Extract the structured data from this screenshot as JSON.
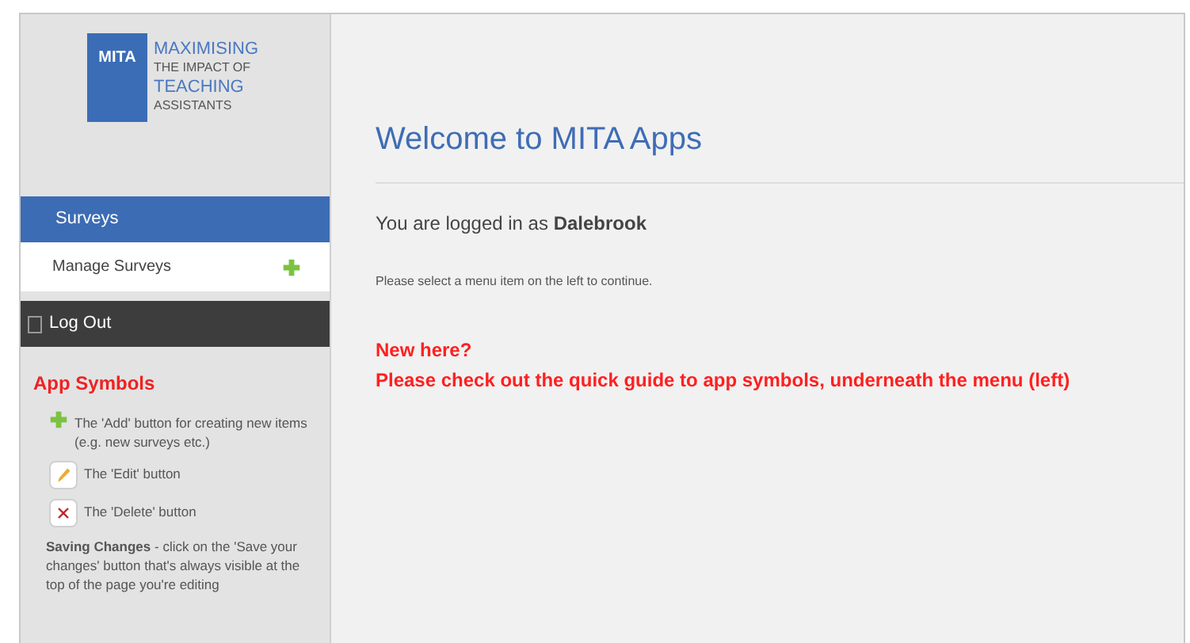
{
  "logo": {
    "badge": "MITA",
    "lines": [
      "MAXIMISING",
      "THE IMPACT OF",
      "TEACHING",
      "ASSISTANTS"
    ]
  },
  "menu": {
    "section": "Surveys",
    "items": [
      {
        "label": "Manage Surveys",
        "kind": "add"
      }
    ]
  },
  "logout": "Log Out",
  "symbols": {
    "title": "App Symbols",
    "items": [
      {
        "kind": "add",
        "text": "The 'Add' button for creating new items (e.g. new surveys etc.)"
      },
      {
        "kind": "edit",
        "text": "The 'Edit' button"
      },
      {
        "kind": "delete",
        "text": "The 'Delete' button"
      }
    ],
    "note": "**Saving Changes** - click on the 'Save your changes' button that's always visible at the top of the page you're editing"
  },
  "main": {
    "title": "Welcome to MITA Apps",
    "logged_in": "You are logged in as **Dalebrook**",
    "instruction": "Please select a menu item on the left to continue.",
    "notice": [
      "New here?",
      "Please check out the quick guide to app symbols, underneath the menu (left)"
    ]
  }
}
